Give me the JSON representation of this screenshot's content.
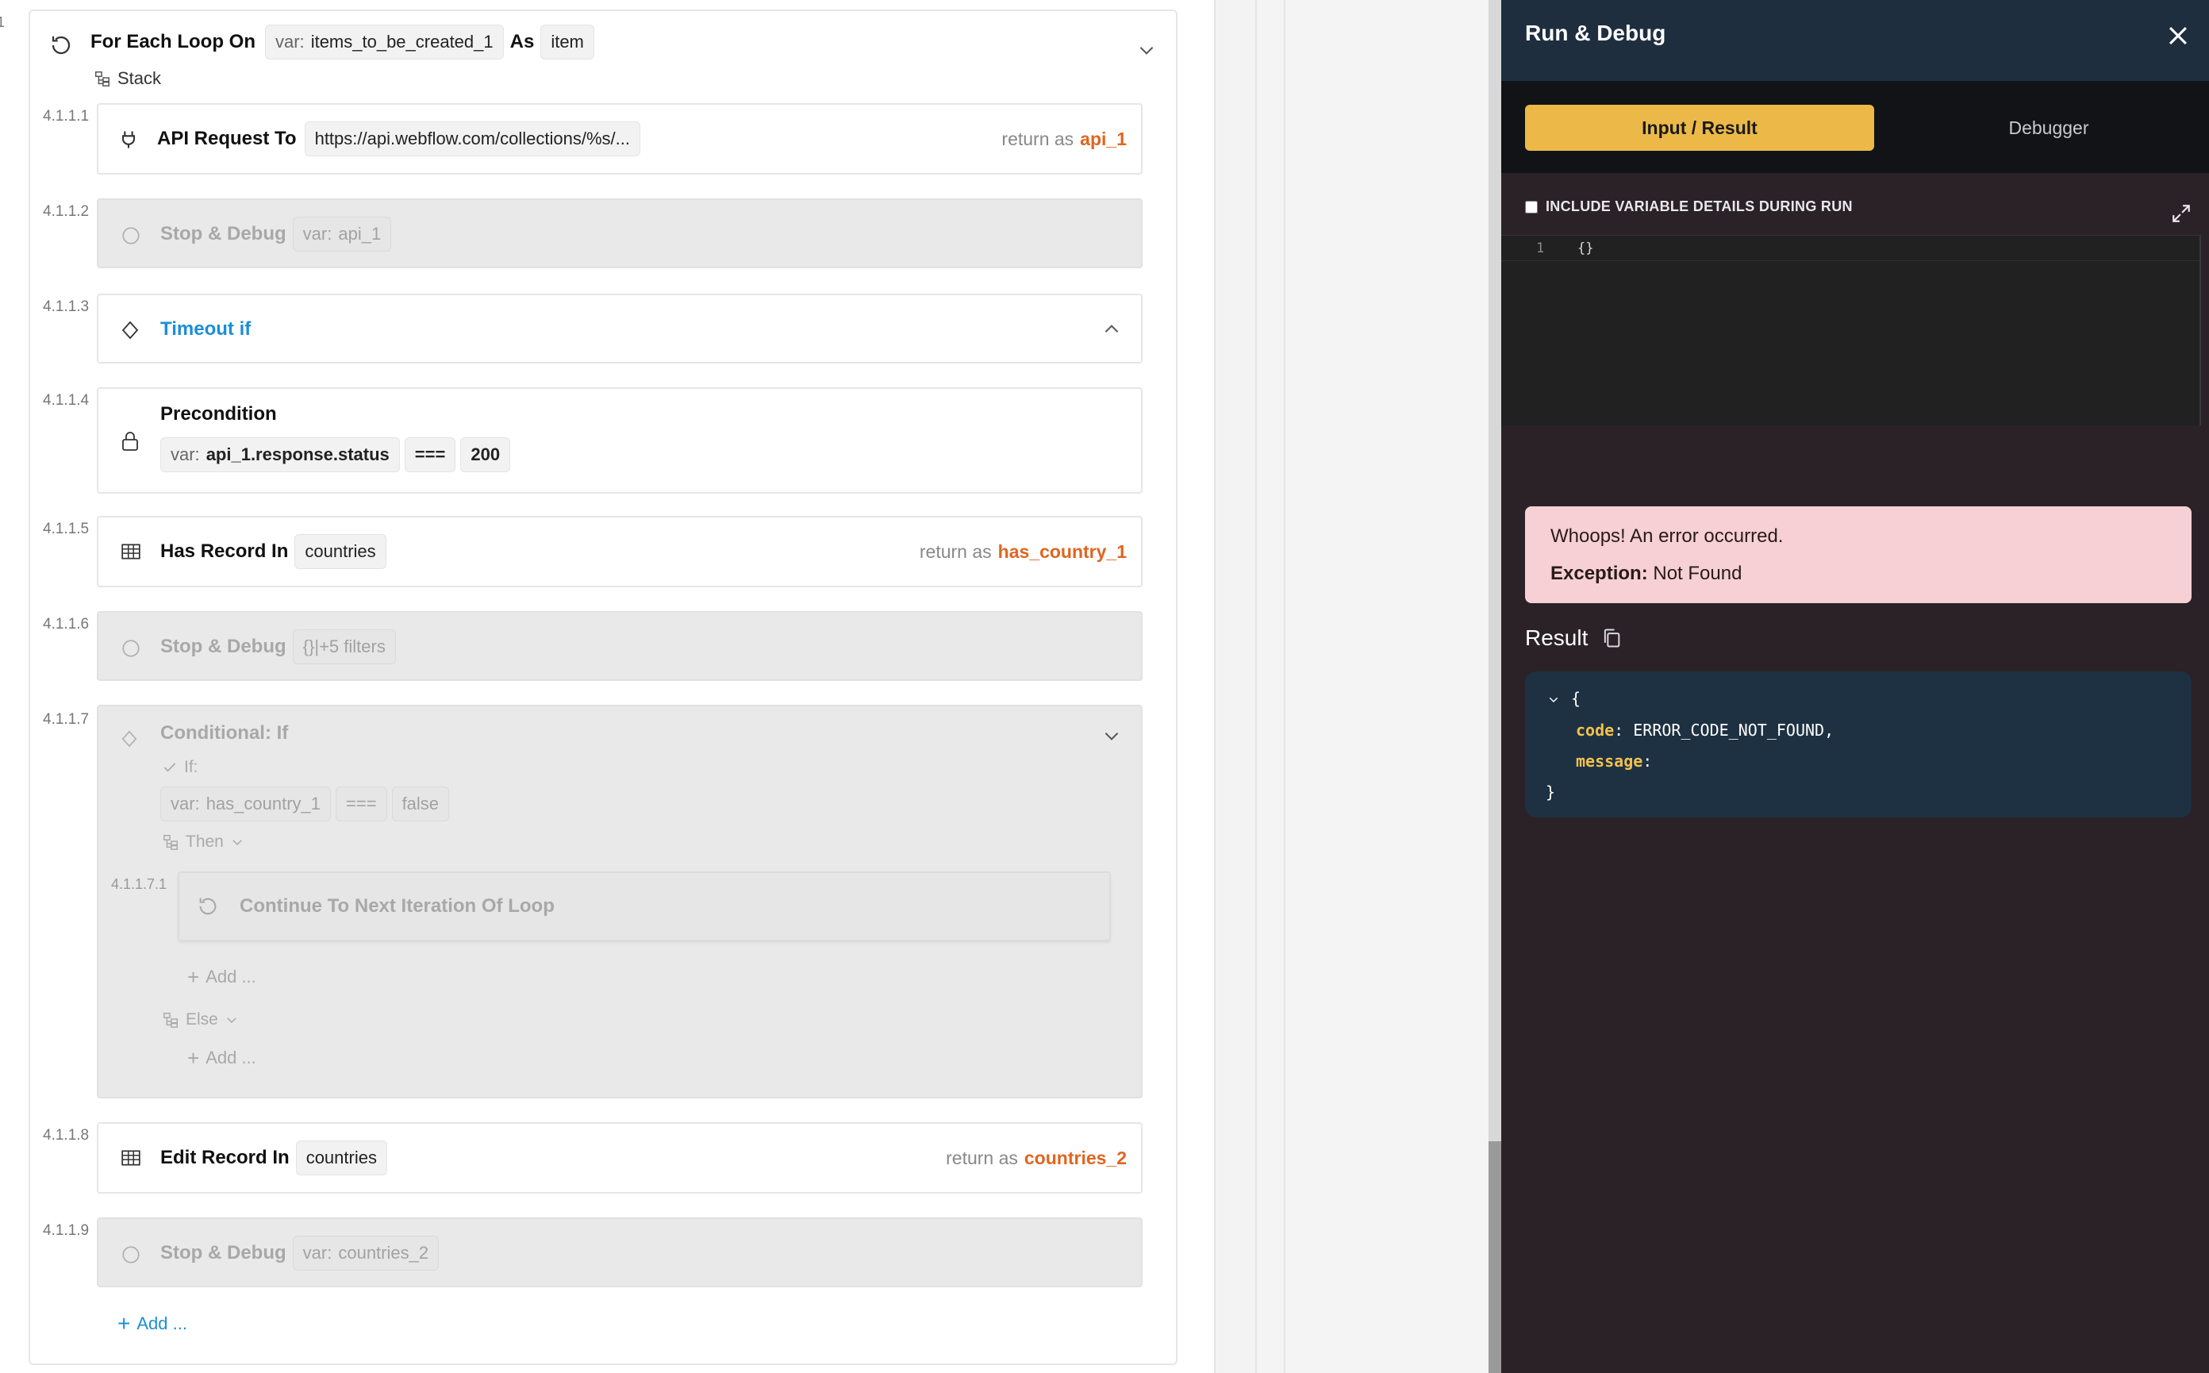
{
  "editor": {
    "loop": {
      "number": "1",
      "title": "For Each Loop On",
      "var_prefix": "var:",
      "var_name": "items_to_be_created_1",
      "as_label": "As",
      "item_label": "item",
      "stack_label": "Stack"
    },
    "steps": {
      "s1": {
        "num": "4.1.1.1",
        "title": "API Request To",
        "url": "https://api.webflow.com/collections/%s/...",
        "return_label": "return as",
        "return_var": "api_1",
        "icon": "plug-icon"
      },
      "s2": {
        "num": "4.1.1.2",
        "title": "Stop & Debug",
        "var_prefix": "var:",
        "var_name": "api_1"
      },
      "s3": {
        "num": "4.1.1.3",
        "title": "Timeout if"
      },
      "s4": {
        "num": "4.1.1.4",
        "title": "Precondition",
        "var_prefix": "var:",
        "var_name": "api_1.response.status",
        "operator": "===",
        "value": "200"
      },
      "s5": {
        "num": "4.1.1.5",
        "title": "Has Record In",
        "table": "countries",
        "return_label": "return as",
        "return_var": "has_country_1"
      },
      "s6": {
        "num": "4.1.1.6",
        "title": "Stop & Debug",
        "filters": "{}|+5 filters"
      },
      "s7": {
        "num": "4.1.1.7",
        "title": "Conditional: If",
        "if_label": "If:",
        "var_prefix": "var:",
        "var_name": "has_country_1",
        "operator": "===",
        "value": "false",
        "then_label": "Then",
        "sub_num": "4.1.1.7.1",
        "sub_title": "Continue To Next Iteration Of Loop",
        "add_label": "Add ...",
        "else_label": "Else",
        "else_add_label": "Add ..."
      },
      "s8": {
        "num": "4.1.1.8",
        "title": "Edit Record In",
        "table": "countries",
        "return_label": "return as",
        "return_var": "countries_2"
      },
      "s9": {
        "num": "4.1.1.9",
        "title": "Stop & Debug",
        "var_prefix": "var:",
        "var_name": "countries_2"
      }
    },
    "add_label": "Add ..."
  },
  "panel": {
    "title": "Run & Debug",
    "tabs": [
      "Input / Result",
      "Debugger"
    ],
    "include_vars_label": "INCLUDE VARIABLE DETAILS DURING RUN",
    "code": {
      "line_number": "1",
      "content": "{}"
    },
    "error": {
      "message": "Whoops! An error occurred.",
      "exception_label": "Exception:",
      "exception_value": "Not Found"
    },
    "result": {
      "title": "Result",
      "open_brace": "{",
      "close_brace": "}",
      "code_key": "code",
      "code_value": "ERROR_CODE_NOT_FOUND,",
      "message_key": "message",
      "message_value": ""
    }
  },
  "colors": {
    "accent_orange": "#e0651f",
    "link_blue": "#1b8fd6",
    "tab_active": "#ecb948",
    "panel_header": "#1e2e3f",
    "error_bg": "#f6d0d5"
  }
}
